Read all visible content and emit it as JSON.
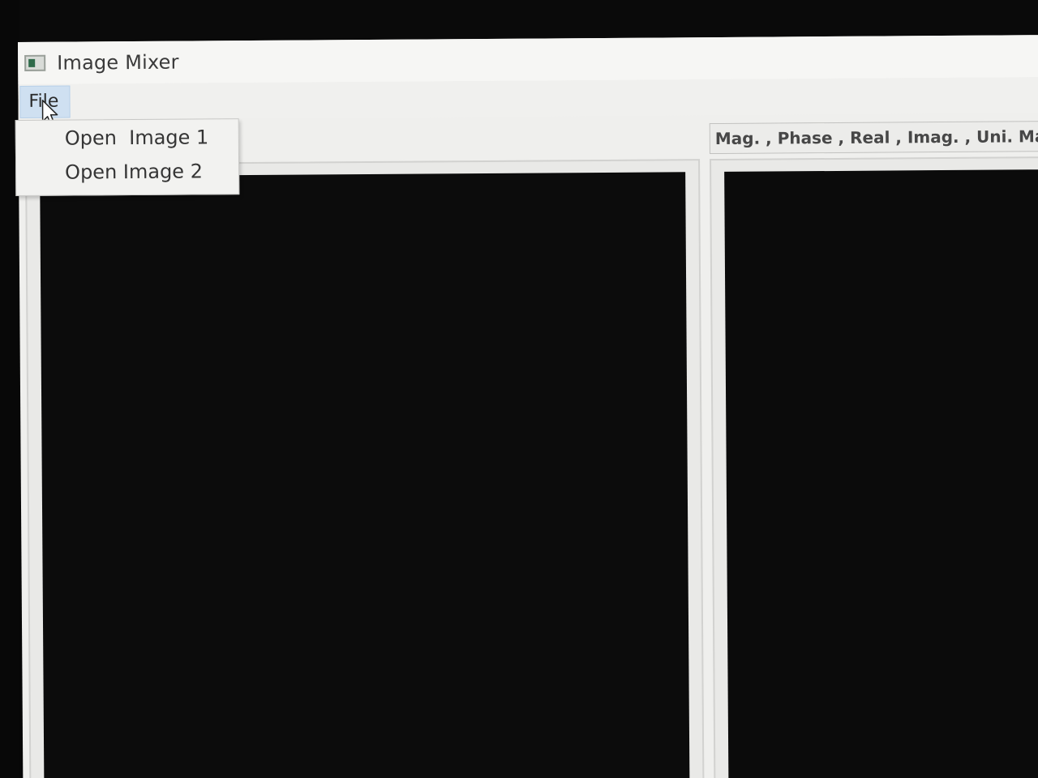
{
  "window": {
    "title": "Image Mixer",
    "icon": "app-icon"
  },
  "menu_bar": {
    "file_label": "File"
  },
  "file_menu": {
    "items": [
      {
        "label": "Open  Image 1"
      },
      {
        "label": "Open Image 2"
      }
    ]
  },
  "right_panel": {
    "component_selector_value": "Mag. , Phase , Real , Imag. , Uni. Ma"
  },
  "colors": {
    "menu_highlight": "#cfe0f1",
    "image_background": "#0c0c0c",
    "window_background": "#efefed"
  }
}
